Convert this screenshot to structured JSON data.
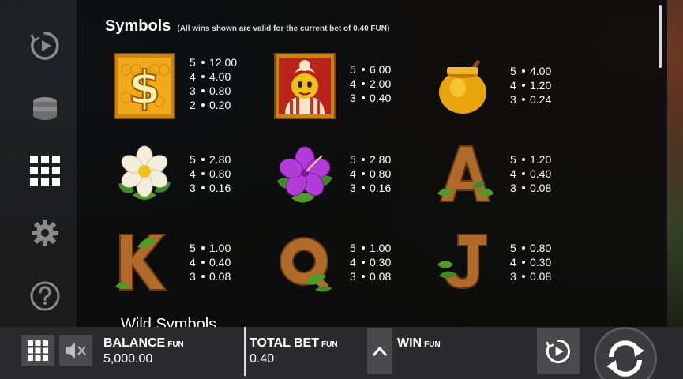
{
  "paytable": {
    "title": "Symbols",
    "subtitle": "(All wins shown are valid for the current bet of 0.40 FUN)",
    "wild_heading": "Wild Symbols",
    "symbols": [
      {
        "name": "dollar-symbol",
        "icon": "golden-dollar-sign-tile",
        "pays": [
          {
            "count": "5",
            "value": "12.00"
          },
          {
            "count": "4",
            "value": "4.00"
          },
          {
            "count": "3",
            "value": "0.80"
          },
          {
            "count": "2",
            "value": "0.20"
          }
        ]
      },
      {
        "name": "bee-queen-symbol",
        "icon": "queen-bee-character-tile",
        "pays": [
          {
            "count": "5",
            "value": "6.00"
          },
          {
            "count": "4",
            "value": "2.00"
          },
          {
            "count": "3",
            "value": "0.40"
          }
        ]
      },
      {
        "name": "honey-pot-symbol",
        "icon": "honey-pot",
        "pays": [
          {
            "count": "5",
            "value": "4.00"
          },
          {
            "count": "4",
            "value": "1.20"
          },
          {
            "count": "3",
            "value": "0.24"
          }
        ]
      },
      {
        "name": "white-flower-symbol",
        "icon": "white-daisy-flower",
        "pays": [
          {
            "count": "5",
            "value": "2.80"
          },
          {
            "count": "4",
            "value": "0.80"
          },
          {
            "count": "3",
            "value": "0.16"
          }
        ]
      },
      {
        "name": "hibiscus-symbol",
        "icon": "purple-hibiscus-flower",
        "pays": [
          {
            "count": "5",
            "value": "2.80"
          },
          {
            "count": "4",
            "value": "0.80"
          },
          {
            "count": "3",
            "value": "0.16"
          }
        ]
      },
      {
        "name": "letter-a-symbol",
        "icon": "wooden-letter-a",
        "pays": [
          {
            "count": "5",
            "value": "1.20"
          },
          {
            "count": "4",
            "value": "0.40"
          },
          {
            "count": "3",
            "value": "0.08"
          }
        ]
      },
      {
        "name": "letter-k-symbol",
        "icon": "wooden-letter-k",
        "pays": [
          {
            "count": "5",
            "value": "1.00"
          },
          {
            "count": "4",
            "value": "0.40"
          },
          {
            "count": "3",
            "value": "0.08"
          }
        ]
      },
      {
        "name": "letter-q-symbol",
        "icon": "wooden-letter-q",
        "pays": [
          {
            "count": "5",
            "value": "1.00"
          },
          {
            "count": "4",
            "value": "0.30"
          },
          {
            "count": "3",
            "value": "0.08"
          }
        ]
      },
      {
        "name": "letter-j-symbol",
        "icon": "wooden-letter-j",
        "pays": [
          {
            "count": "5",
            "value": "0.80"
          },
          {
            "count": "4",
            "value": "0.30"
          },
          {
            "count": "3",
            "value": "0.08"
          }
        ]
      }
    ]
  },
  "side_menu": {
    "items": [
      "autoplay-icon",
      "coins-icon",
      "paytable-grid-icon",
      "gear-icon",
      "help-icon"
    ]
  },
  "bottom_bar": {
    "balance_label": "BALANCE",
    "balance_currency": "FUN",
    "balance_value": "5,000.00",
    "total_bet_label": "TOTAL BET",
    "total_bet_currency": "FUN",
    "total_bet_value": "0.40",
    "win_label": "WIN",
    "win_currency": "FUN"
  },
  "colors": {
    "panel": "#0c0c0c",
    "bar": "#2b2b2d",
    "button": "#4a4a4d",
    "gold": "#f2b51c",
    "wood": "#b06a2a",
    "leaf": "#4f9a2b"
  }
}
